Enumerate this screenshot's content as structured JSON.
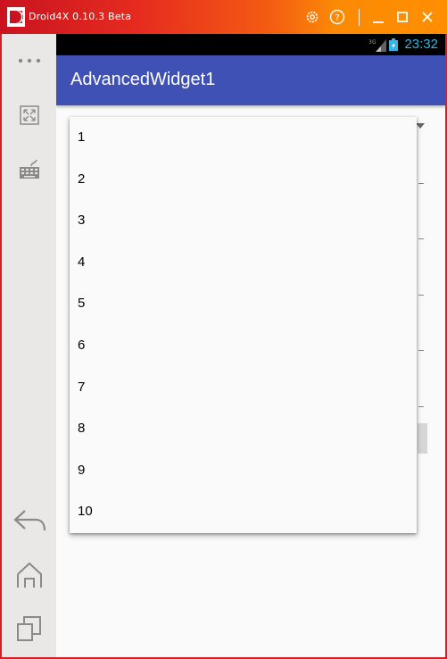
{
  "window": {
    "title": "Droid4X 0.10.3 Beta"
  },
  "sidebar": {
    "more_icon": "more-dots-icon",
    "fullscreen_icon": "fullscreen-icon",
    "keyboard_icon": "keyboard-icon",
    "back_icon": "back-arrow-icon",
    "home_icon": "home-icon",
    "recents_icon": "recent-apps-icon"
  },
  "status_bar": {
    "network": "3G",
    "time": "23:32"
  },
  "app": {
    "title": "AdvancedWidget1"
  },
  "dropdown": {
    "items": [
      "1",
      "2",
      "3",
      "4",
      "5",
      "6",
      "7",
      "8",
      "9",
      "10"
    ]
  },
  "colors": {
    "title_gradient_start": "#c9141f",
    "title_gradient_end": "#ff8f00",
    "app_bar": "#3f51b5",
    "status_time": "#33b5e5"
  }
}
